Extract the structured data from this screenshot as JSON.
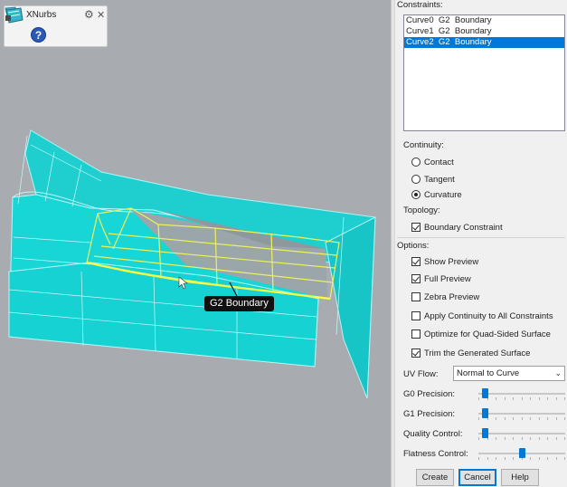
{
  "toolbar": {
    "title": "XNurbs",
    "help_glyph": "?"
  },
  "viewport": {
    "tooltip": "G2 Boundary",
    "surface_color": "#19d3d3",
    "curve_color": "#f0f050"
  },
  "panel": {
    "constraints_label": "Constraints:",
    "constraints": [
      {
        "name": "Curve0",
        "continuity": "G2",
        "type": "Boundary",
        "selected": false
      },
      {
        "name": "Curve1",
        "continuity": "G2",
        "type": "Boundary",
        "selected": false
      },
      {
        "name": "Curve2",
        "continuity": "G2",
        "type": "Boundary",
        "selected": true
      }
    ],
    "continuity_label": "Continuity:",
    "continuity_options": [
      {
        "label": "Contact",
        "checked": false
      },
      {
        "label": "Tangent",
        "checked": false
      },
      {
        "label": "Curvature",
        "checked": true
      }
    ],
    "topology_label": "Topology:",
    "topology_option": {
      "label": "Boundary Constraint",
      "checked": true
    },
    "options_label": "Options:",
    "options": [
      {
        "label": "Show Preview",
        "checked": true
      },
      {
        "label": "Full Preview",
        "checked": true
      },
      {
        "label": "Zebra Preview",
        "checked": false
      },
      {
        "label": "Apply Continuity to All Constraints",
        "checked": false
      },
      {
        "label": "Optimize for Quad-Sided Surface",
        "checked": false
      },
      {
        "label": "Trim the Generated Surface",
        "checked": true
      }
    ],
    "uv_flow_label": "UV Flow:",
    "uv_flow_value": "Normal to Curve",
    "sliders": [
      {
        "label": "G0 Precision:",
        "value": 0.04
      },
      {
        "label": "G1 Precision:",
        "value": 0.04
      },
      {
        "label": "Quality Control:",
        "value": 0.04
      },
      {
        "label": "Flatness Control:",
        "value": 0.5
      }
    ],
    "buttons": {
      "create": "Create",
      "cancel": "Cancel",
      "help": "Help"
    },
    "accent_color": "#0078d7"
  }
}
